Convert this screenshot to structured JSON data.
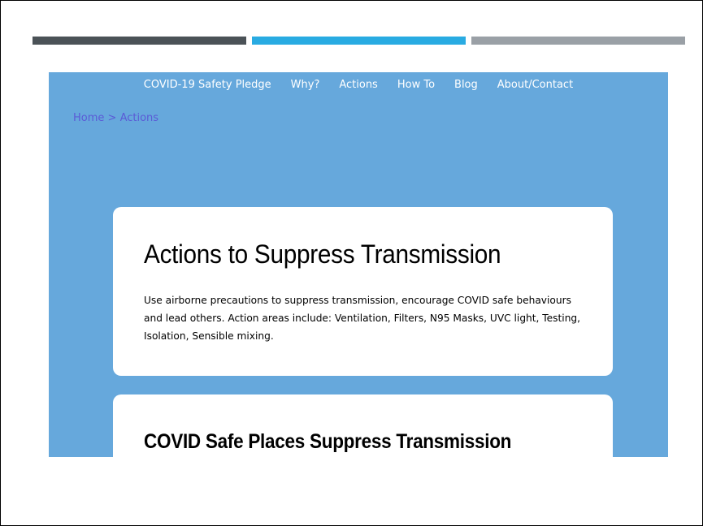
{
  "colors": {
    "bar_dark": "#4b5257",
    "bar_blue": "#29abe2",
    "bar_gray": "#9aa0a6",
    "page_background": "#66a8dc",
    "nav_text": "#ffffff",
    "breadcrumb_link": "#5b5bd6",
    "card_background": "#ffffff"
  },
  "nav": {
    "items": [
      {
        "label": "COVID-19 Safety Pledge"
      },
      {
        "label": "Why?"
      },
      {
        "label": "Actions"
      },
      {
        "label": "How To"
      },
      {
        "label": "Blog"
      },
      {
        "label": "About/Contact"
      }
    ]
  },
  "breadcrumb": {
    "home": "Home",
    "separator": " > ",
    "current": "Actions"
  },
  "cards": [
    {
      "title": "Actions to Suppress Transmission",
      "text": "Use airborne precautions to suppress transmission, encourage COVID safe behaviours and lead others. Action areas include: Ventilation, Filters, N95 Masks, UVC light, Testing, Isolation, Sensible mixing."
    },
    {
      "title": "COVID Safe Places Suppress Transmission"
    }
  ]
}
